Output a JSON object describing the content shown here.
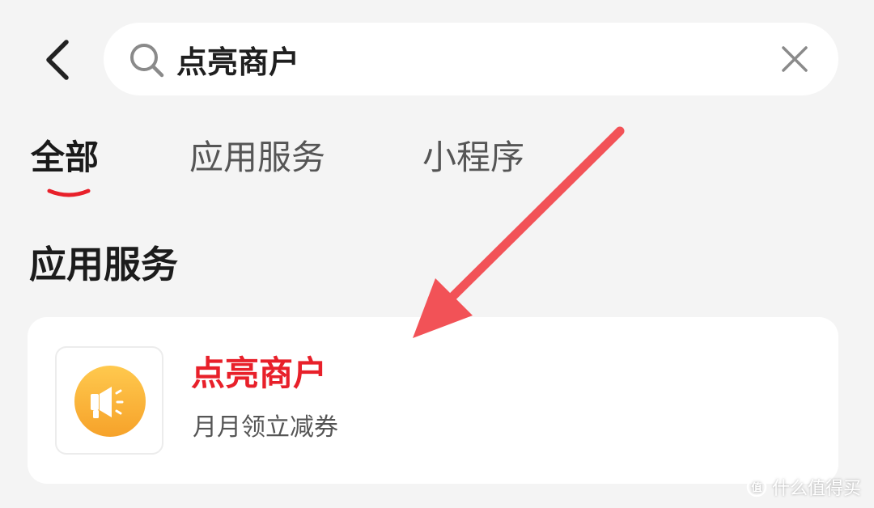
{
  "header": {
    "back_icon": "chevron-left-icon",
    "search": {
      "value": "点亮商户",
      "icon": "search-icon",
      "clear_icon": "close-icon"
    }
  },
  "tabs": [
    {
      "label": "全部",
      "active": true
    },
    {
      "label": "应用服务",
      "active": false
    },
    {
      "label": "小程序",
      "active": false
    }
  ],
  "section": {
    "title": "应用服务"
  },
  "result": {
    "title": "点亮商户",
    "subtitle": "月月领立减券",
    "icon": "megaphone-icon"
  },
  "watermark": {
    "text": "什么值得买"
  },
  "colors": {
    "background": "#f4f4f4",
    "accent_red": "#e8202a",
    "arrow": "#f25257",
    "icon_orange_start": "#ffc64a",
    "icon_orange_end": "#f7a52b"
  }
}
